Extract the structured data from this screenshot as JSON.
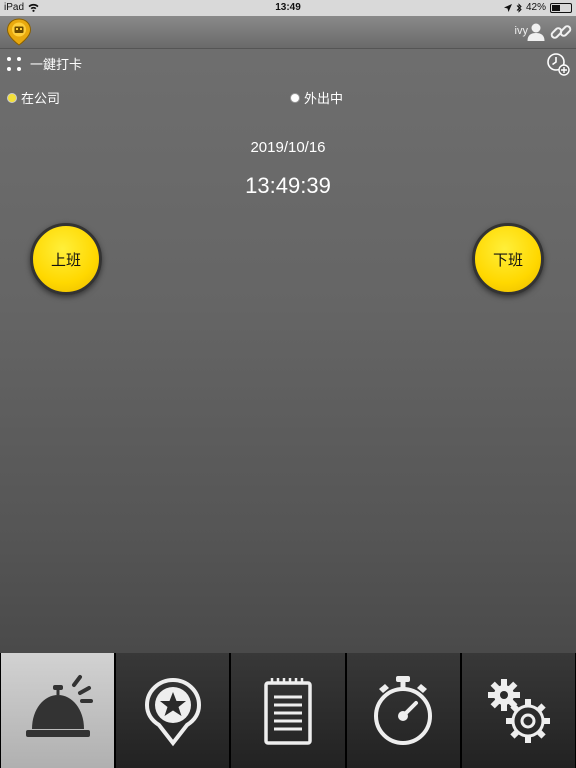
{
  "statusbar": {
    "device": "iPad",
    "time": "13:49",
    "battery": "42%"
  },
  "header": {
    "username": "ivy",
    "icons": [
      "app-logo-icon",
      "user-icon",
      "link-icon"
    ]
  },
  "quick_punch": {
    "label": "一鍵打卡",
    "icon": "grid-dots-icon",
    "right_icon": "clock-add-icon"
  },
  "location_status": {
    "options": [
      {
        "label": "在公司",
        "selected": true
      },
      {
        "label": "外出中",
        "selected": false
      }
    ]
  },
  "clock": {
    "date": "2019/10/16",
    "time": "13:49:39"
  },
  "buttons": {
    "clock_in": "上班",
    "clock_out": "下班"
  },
  "tabs": [
    {
      "icon": "service-bell-icon",
      "active": true
    },
    {
      "icon": "location-star-icon",
      "active": false
    },
    {
      "icon": "notepad-icon",
      "active": false
    },
    {
      "icon": "stopwatch-icon",
      "active": false
    },
    {
      "icon": "gears-icon",
      "active": false
    }
  ],
  "colors": {
    "accent_yellow": "#ffd800",
    "active_tab": "#c4c4c4",
    "inactive_tab": "#2a2a2a"
  }
}
